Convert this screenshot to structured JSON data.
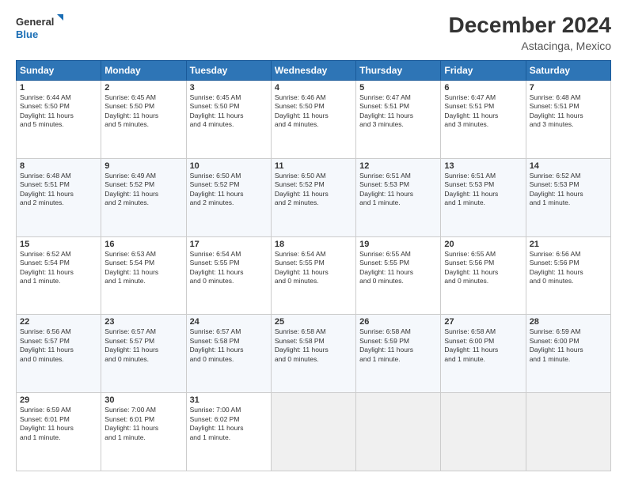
{
  "logo": {
    "line1": "General",
    "line2": "Blue"
  },
  "title": "December 2024",
  "subtitle": "Astacinga, Mexico",
  "header_days": [
    "Sunday",
    "Monday",
    "Tuesday",
    "Wednesday",
    "Thursday",
    "Friday",
    "Saturday"
  ],
  "weeks": [
    [
      {
        "day": "1",
        "info": "Sunrise: 6:44 AM\nSunset: 5:50 PM\nDaylight: 11 hours\nand 5 minutes."
      },
      {
        "day": "2",
        "info": "Sunrise: 6:45 AM\nSunset: 5:50 PM\nDaylight: 11 hours\nand 5 minutes."
      },
      {
        "day": "3",
        "info": "Sunrise: 6:45 AM\nSunset: 5:50 PM\nDaylight: 11 hours\nand 4 minutes."
      },
      {
        "day": "4",
        "info": "Sunrise: 6:46 AM\nSunset: 5:50 PM\nDaylight: 11 hours\nand 4 minutes."
      },
      {
        "day": "5",
        "info": "Sunrise: 6:47 AM\nSunset: 5:51 PM\nDaylight: 11 hours\nand 3 minutes."
      },
      {
        "day": "6",
        "info": "Sunrise: 6:47 AM\nSunset: 5:51 PM\nDaylight: 11 hours\nand 3 minutes."
      },
      {
        "day": "7",
        "info": "Sunrise: 6:48 AM\nSunset: 5:51 PM\nDaylight: 11 hours\nand 3 minutes."
      }
    ],
    [
      {
        "day": "8",
        "info": "Sunrise: 6:48 AM\nSunset: 5:51 PM\nDaylight: 11 hours\nand 2 minutes."
      },
      {
        "day": "9",
        "info": "Sunrise: 6:49 AM\nSunset: 5:52 PM\nDaylight: 11 hours\nand 2 minutes."
      },
      {
        "day": "10",
        "info": "Sunrise: 6:50 AM\nSunset: 5:52 PM\nDaylight: 11 hours\nand 2 minutes."
      },
      {
        "day": "11",
        "info": "Sunrise: 6:50 AM\nSunset: 5:52 PM\nDaylight: 11 hours\nand 2 minutes."
      },
      {
        "day": "12",
        "info": "Sunrise: 6:51 AM\nSunset: 5:53 PM\nDaylight: 11 hours\nand 1 minute."
      },
      {
        "day": "13",
        "info": "Sunrise: 6:51 AM\nSunset: 5:53 PM\nDaylight: 11 hours\nand 1 minute."
      },
      {
        "day": "14",
        "info": "Sunrise: 6:52 AM\nSunset: 5:53 PM\nDaylight: 11 hours\nand 1 minute."
      }
    ],
    [
      {
        "day": "15",
        "info": "Sunrise: 6:52 AM\nSunset: 5:54 PM\nDaylight: 11 hours\nand 1 minute."
      },
      {
        "day": "16",
        "info": "Sunrise: 6:53 AM\nSunset: 5:54 PM\nDaylight: 11 hours\nand 1 minute."
      },
      {
        "day": "17",
        "info": "Sunrise: 6:54 AM\nSunset: 5:55 PM\nDaylight: 11 hours\nand 0 minutes."
      },
      {
        "day": "18",
        "info": "Sunrise: 6:54 AM\nSunset: 5:55 PM\nDaylight: 11 hours\nand 0 minutes."
      },
      {
        "day": "19",
        "info": "Sunrise: 6:55 AM\nSunset: 5:55 PM\nDaylight: 11 hours\nand 0 minutes."
      },
      {
        "day": "20",
        "info": "Sunrise: 6:55 AM\nSunset: 5:56 PM\nDaylight: 11 hours\nand 0 minutes."
      },
      {
        "day": "21",
        "info": "Sunrise: 6:56 AM\nSunset: 5:56 PM\nDaylight: 11 hours\nand 0 minutes."
      }
    ],
    [
      {
        "day": "22",
        "info": "Sunrise: 6:56 AM\nSunset: 5:57 PM\nDaylight: 11 hours\nand 0 minutes."
      },
      {
        "day": "23",
        "info": "Sunrise: 6:57 AM\nSunset: 5:57 PM\nDaylight: 11 hours\nand 0 minutes."
      },
      {
        "day": "24",
        "info": "Sunrise: 6:57 AM\nSunset: 5:58 PM\nDaylight: 11 hours\nand 0 minutes."
      },
      {
        "day": "25",
        "info": "Sunrise: 6:58 AM\nSunset: 5:58 PM\nDaylight: 11 hours\nand 0 minutes."
      },
      {
        "day": "26",
        "info": "Sunrise: 6:58 AM\nSunset: 5:59 PM\nDaylight: 11 hours\nand 1 minute."
      },
      {
        "day": "27",
        "info": "Sunrise: 6:58 AM\nSunset: 6:00 PM\nDaylight: 11 hours\nand 1 minute."
      },
      {
        "day": "28",
        "info": "Sunrise: 6:59 AM\nSunset: 6:00 PM\nDaylight: 11 hours\nand 1 minute."
      }
    ],
    [
      {
        "day": "29",
        "info": "Sunrise: 6:59 AM\nSunset: 6:01 PM\nDaylight: 11 hours\nand 1 minute."
      },
      {
        "day": "30",
        "info": "Sunrise: 7:00 AM\nSunset: 6:01 PM\nDaylight: 11 hours\nand 1 minute."
      },
      {
        "day": "31",
        "info": "Sunrise: 7:00 AM\nSunset: 6:02 PM\nDaylight: 11 hours\nand 1 minute."
      },
      null,
      null,
      null,
      null
    ]
  ]
}
